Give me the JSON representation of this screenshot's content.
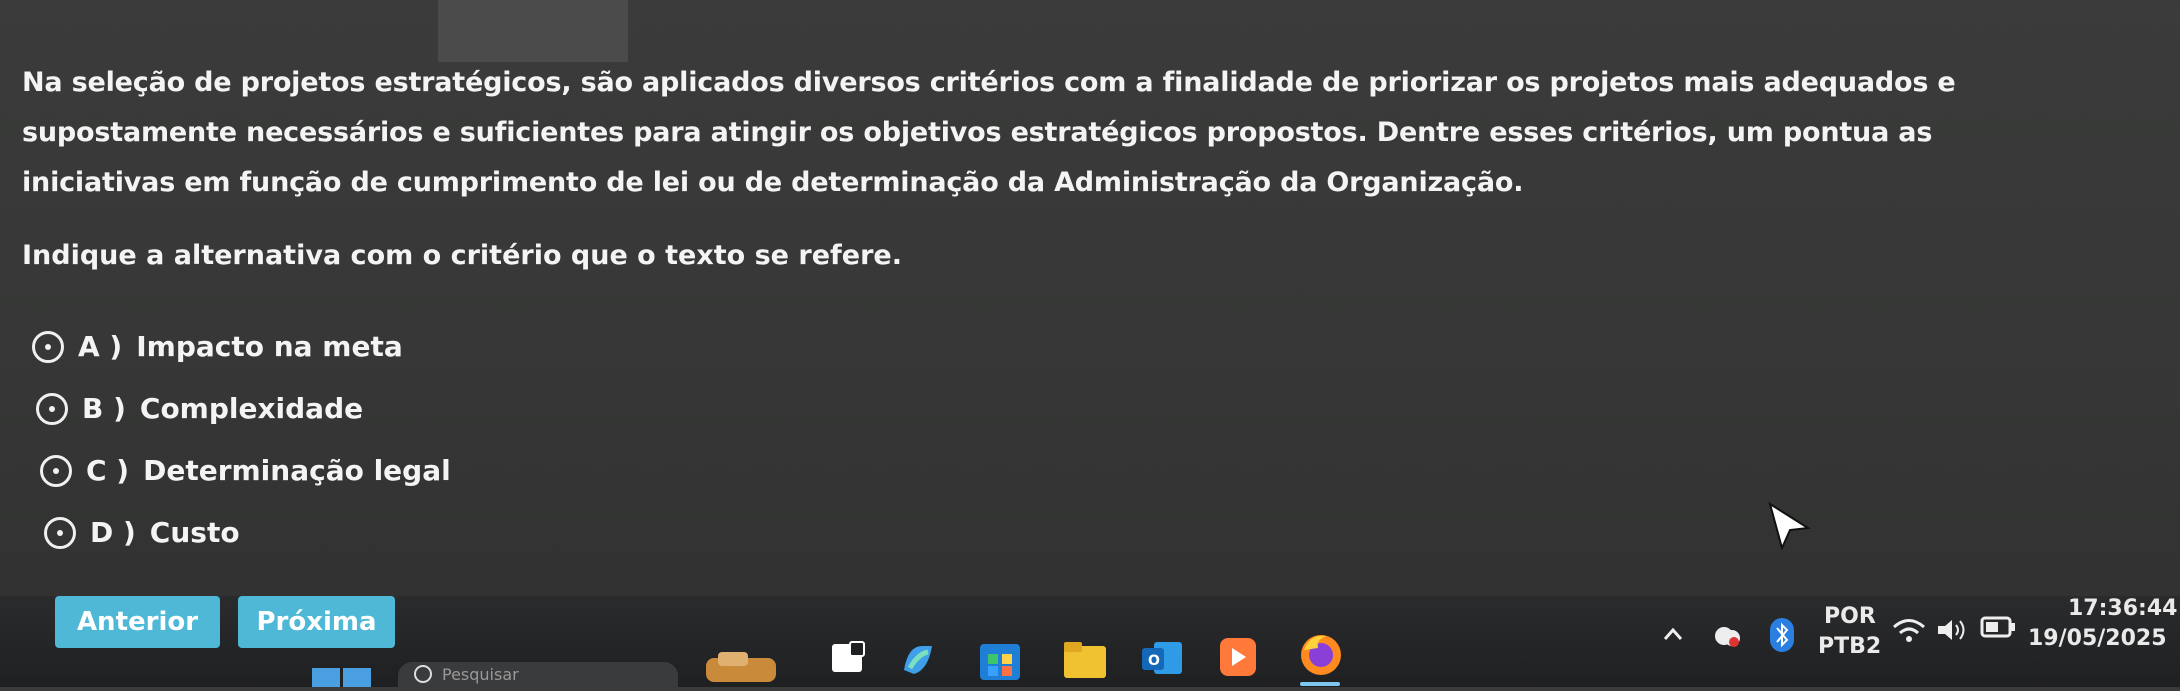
{
  "question": {
    "text": "Na seleção de projetos estratégicos, são aplicados diversos critérios com a finalidade de priorizar os projetos mais adequados e supostamente necessários e suficientes para atingir os objetivos estratégicos propostos. Dentre esses critérios, um pontua as iniciativas em função de cumprimento de lei ou de determinação da Administração da Organização.",
    "instruction": "Indique a alternativa com o critério que o texto se refere."
  },
  "options": [
    {
      "letter": "A )",
      "label": "Impacto na meta"
    },
    {
      "letter": "B )",
      "label": "Complexidade"
    },
    {
      "letter": "C )",
      "label": "Determinação legal"
    },
    {
      "letter": "D )",
      "label": "Custo"
    }
  ],
  "nav": {
    "prev_label": "Anterior",
    "next_label": "Próxima",
    "button_color": "#4eb8d6"
  },
  "taskbar": {
    "search_placeholder": "Pesquisar",
    "language_top": "POR",
    "language_bottom": "PTB2",
    "time": "17:36:44",
    "date": "19/05/2025",
    "icons": [
      "windows-start-icon",
      "search-icon",
      "widgets-icon",
      "task-view-icon",
      "copilot-icon",
      "store-icon",
      "file-explorer-icon",
      "outlook-icon",
      "media-player-icon",
      "firefox-icon"
    ]
  }
}
